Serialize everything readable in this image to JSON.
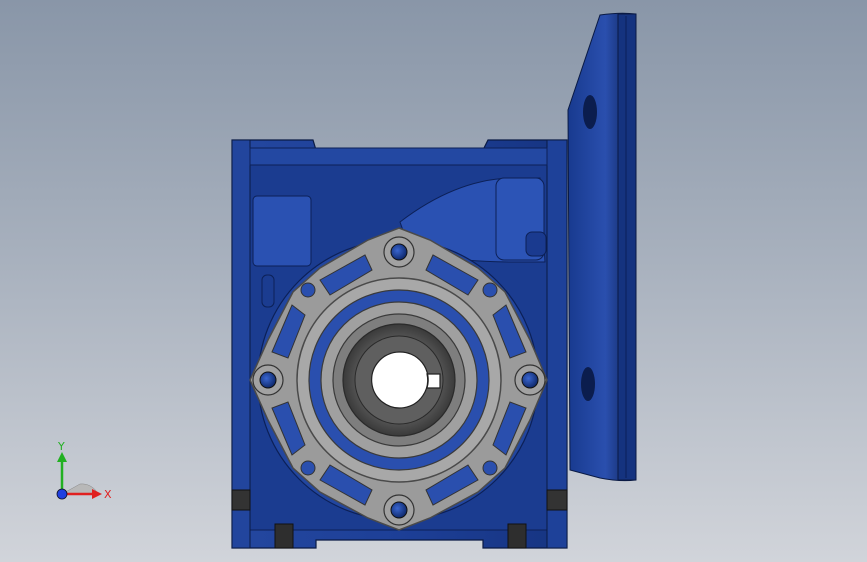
{
  "triad": {
    "x_label": "X",
    "y_label": "Y",
    "x_color": "#e02020",
    "y_color": "#22b022",
    "z_color": "#2040e0"
  },
  "model": {
    "body_color": "#1d3f97",
    "body_dark": "#102a6b",
    "cover_color": "#9a9a9a",
    "hub_color": "#5a5a5a"
  }
}
